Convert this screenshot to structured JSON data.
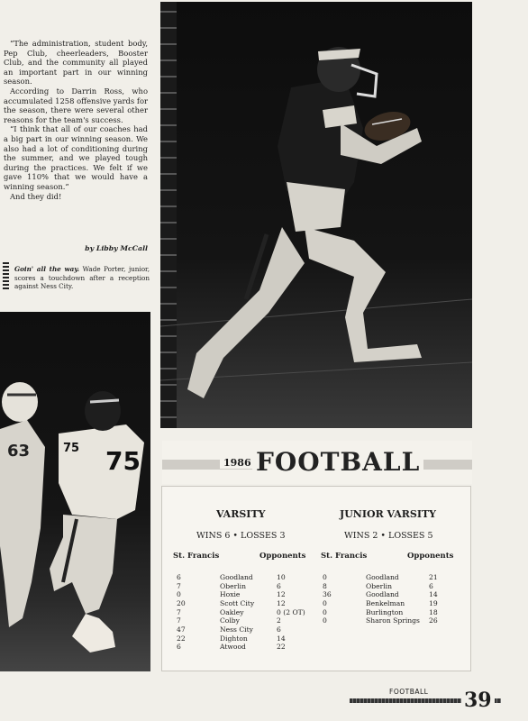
{
  "story": {
    "paragraphs": [
      "“The administration, student body, Pep Club, cheerleaders, Booster Club, and the community all played an important part in our winning season.",
      "According to Darrin Ross, who accumulated 1258 offensive yards for the season, there were several other reasons for the team's success.",
      "“I think that all of our coaches had a big part in our winning season. We also had a lot of conditioning during the summer, and we played tough during the practices. We felt if we gave 110% that we would have a winning season.”",
      "And they did!"
    ],
    "byline": "by Libby McCall"
  },
  "caption": {
    "lead": "Goin' all the way.",
    "text": "Wade Porter, junior, scores a touchdown after a reception against Ness City."
  },
  "header": {
    "year": "1986",
    "title": "FOOTBALL"
  },
  "varsity": {
    "title": "VARSITY",
    "record": "WINS 6 • LOSSES 3",
    "col_team": "St. Francis",
    "col_opp": "Opponents",
    "games": [
      {
        "us": "6",
        "opponent": "Goodland",
        "them": "10"
      },
      {
        "us": "7",
        "opponent": "Oberlin",
        "them": "6"
      },
      {
        "us": "0",
        "opponent": "Hoxie",
        "them": "12"
      },
      {
        "us": "20",
        "opponent": "Scott City",
        "them": "12"
      },
      {
        "us": "7",
        "opponent": "Oakley",
        "them": "0 (2 OT)"
      },
      {
        "us": "7",
        "opponent": "Colby",
        "them": "2"
      },
      {
        "us": "47",
        "opponent": "Ness City",
        "them": "6"
      },
      {
        "us": "22",
        "opponent": "Dighton",
        "them": "14"
      },
      {
        "us": "6",
        "opponent": "Atwood",
        "them": "22"
      }
    ]
  },
  "jv": {
    "title": "JUNIOR VARSITY",
    "record": "WINS 2 • LOSSES 5",
    "col_team": "St. Francis",
    "col_opp": "Opponents",
    "games": [
      {
        "us": "0",
        "opponent": "Goodland",
        "them": "21"
      },
      {
        "us": "8",
        "opponent": "Oberlin",
        "them": "6"
      },
      {
        "us": "36",
        "opponent": "Goodland",
        "them": "14"
      },
      {
        "us": "0",
        "opponent": "Benkelman",
        "them": "19"
      },
      {
        "us": "0",
        "opponent": "Burlington",
        "them": "18"
      },
      {
        "us": "0",
        "opponent": "Sharon Springs",
        "them": "26"
      }
    ]
  },
  "footer": {
    "label": "FOOTBALL",
    "page": "39"
  },
  "photo_main_jersey": "",
  "photo_left_numbers": [
    "75"
  ]
}
